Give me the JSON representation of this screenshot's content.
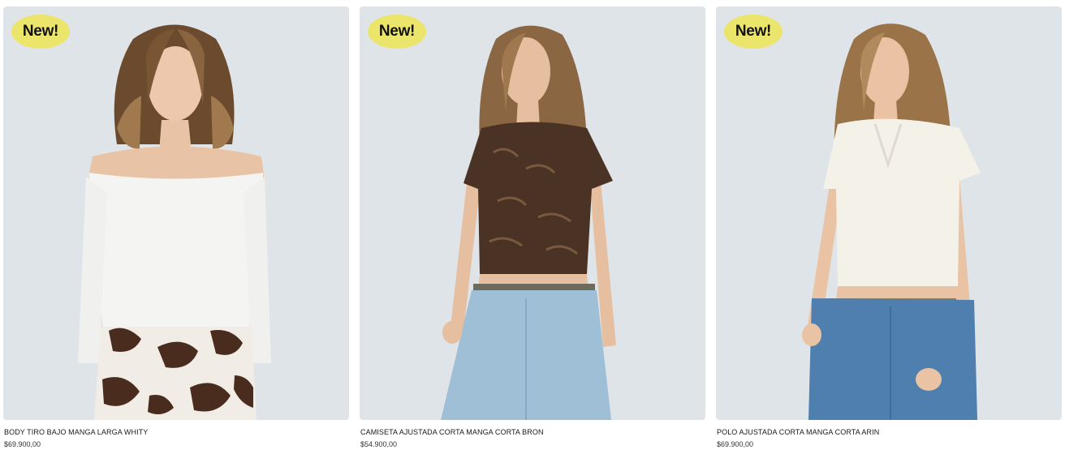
{
  "products": [
    {
      "badge": "New!",
      "name": "BODY TIRO BAJO MANGA LARGA WHITY",
      "price": "$69.900,00",
      "top_color": "#f4f4f2",
      "bottom": "cow-print-pants"
    },
    {
      "badge": "New!",
      "name": "CAMISETA AJUSTADA CORTA MANGA CORTA BRON",
      "price": "$54.900,00",
      "top_color": "#4a3224",
      "bottom": "light-denim-jeans"
    },
    {
      "badge": "New!",
      "name": "POLO AJUSTADA CORTA MANGA CORTA ARIN",
      "price": "$69.900,00",
      "top_color": "#f3f1e8",
      "bottom": "blue-denim-jeans"
    }
  ],
  "colors": {
    "badge_bg": "#ece56b",
    "photo_bg": "#dfe4e8"
  }
}
